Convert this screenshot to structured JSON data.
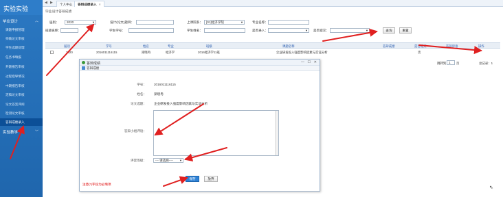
{
  "sidebar": {
    "logo": "实验实验",
    "group1": "毕业设计",
    "items": [
      {
        "label": "课题申报管理",
        "active": false
      },
      {
        "label": "师确论文审核",
        "active": false
      },
      {
        "label": "学生选题处理",
        "active": false
      },
      {
        "label": "任务书填报",
        "active": false
      },
      {
        "label": "开题报告审核",
        "active": false
      },
      {
        "label": "过程指导情况",
        "active": false
      },
      {
        "label": "中期报告审核",
        "active": false
      },
      {
        "label": "定稿论文审核",
        "active": false
      },
      {
        "label": "论文答案评阅",
        "active": false
      },
      {
        "label": "检测论文审核",
        "active": false
      },
      {
        "label": "答辩成绩录入",
        "active": true
      }
    ],
    "group2": "实验教学",
    "chevron": "chevron-down-icon"
  },
  "tabs": [
    {
      "label": "个人中心",
      "active": false
    },
    {
      "label": "答辩成绩录入",
      "active": true,
      "close": "×"
    }
  ],
  "section_title": "毕业设计答辩成绩",
  "filters": {
    "year_label": "届别：",
    "year_value": "2020",
    "topic_label": "设计(论文)题目：",
    "college_label": "上课院系：",
    "college_value": "[01]经济学院",
    "major_label": "专业名称：",
    "class_label": "班级名称：",
    "student_no_label": "学生学号：",
    "student_name_label": "学生姓名：",
    "guide_label": "是否录入：",
    "submit_label": "是否提交：",
    "query_button": "查询",
    "reset_button": "重置"
  },
  "table": {
    "headers": [
      "届别",
      "学号",
      "姓名",
      "专业",
      "班级",
      "课题名称",
      "答辩成绩",
      "是否提交",
      "答辩评语",
      "操作"
    ],
    "rows": [
      {
        "year": "2020",
        "student_no": "2016011116115",
        "name": "梁晓冉",
        "major": "经济学",
        "class": "2016经济学11班",
        "topic": "企业研发投入强度影响因素与实证分析",
        "score": "",
        "submitted": "否",
        "comment": "",
        "action": ""
      }
    ]
  },
  "pager": {
    "jump_label": "跳转到",
    "jump_value": "1",
    "jump_unit": "页",
    "go_label": "确定",
    "total_text": "总记录：1"
  },
  "dialog": {
    "title": "答辩成绩",
    "subtitle": "答辩成绩",
    "student_no_label": "学号：",
    "student_no": "2016011116115",
    "name_label": "姓名：",
    "name": "梁晓冉",
    "topic_label": "论文选题：",
    "topic": "企业研发投入强度影响因素与实证分析",
    "comment_label": "答辩小组评语：",
    "comment_value": "",
    "grade_label": "评定等级：",
    "grade_value": "----请选择----",
    "required_mark": "*",
    "save_button": "保存",
    "cancel_button": "放弃",
    "note": "注意(*)字段为必填项"
  },
  "colors": {
    "sidebar_bg": "#1f66ad",
    "accent": "#2e82d6",
    "arrow": "#e02020"
  }
}
